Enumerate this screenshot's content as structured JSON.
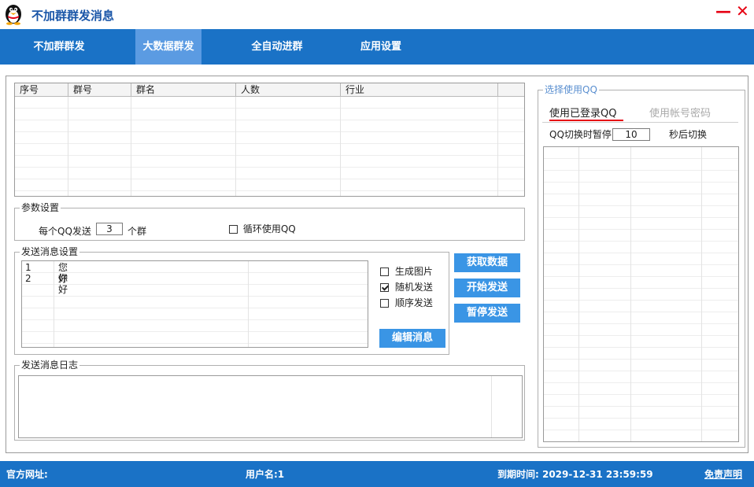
{
  "app": {
    "title": "不加群群发消息"
  },
  "window": {
    "minimize": "—",
    "close": "✕"
  },
  "nav": {
    "tabs": [
      "不加群群发",
      "大数据群发",
      "全自动进群",
      "应用设置"
    ],
    "active": 1
  },
  "group_table": {
    "columns": [
      "序号",
      "群号",
      "群名",
      "人数",
      "行业"
    ]
  },
  "params": {
    "legend": "参数设置",
    "per_qq_label": "每个QQ发送",
    "per_qq_value": "3",
    "per_qq_unit": "个群",
    "loop_label": "循环使用QQ",
    "loop_checked": false
  },
  "message_settings": {
    "legend": "发送消息设置",
    "messages": [
      {
        "no": "1",
        "text": "您好"
      },
      {
        "no": "2",
        "text": "你好"
      }
    ],
    "options": [
      {
        "label": "生成图片",
        "checked": false
      },
      {
        "label": "随机发送",
        "checked": true
      },
      {
        "label": "顺序发送",
        "checked": false
      }
    ],
    "edit_button": "编辑消息"
  },
  "actions": {
    "fetch": "获取数据",
    "start": "开始发送",
    "pause": "暂停发送"
  },
  "log": {
    "legend": "发送消息日志"
  },
  "qq_panel": {
    "legend": "选择使用QQ",
    "tab_logged": "使用已登录QQ",
    "tab_password": "使用帐号密码",
    "switch_label": "QQ切换时暂停",
    "switch_value": "10",
    "switch_unit": "秒后切换"
  },
  "footer": {
    "site_label": "官方网址:",
    "user_label": "用户名:1",
    "expire_label": "到期时间: 2029-12-31 23:59:59",
    "disclaimer": "免责声明"
  },
  "colors": {
    "nav": "#1a72c6",
    "nav_active": "#5b9be2",
    "button": "#3a95e5",
    "title": "#1a56a8",
    "window_controls": "#e60012",
    "tab_underline": "#e60012"
  }
}
